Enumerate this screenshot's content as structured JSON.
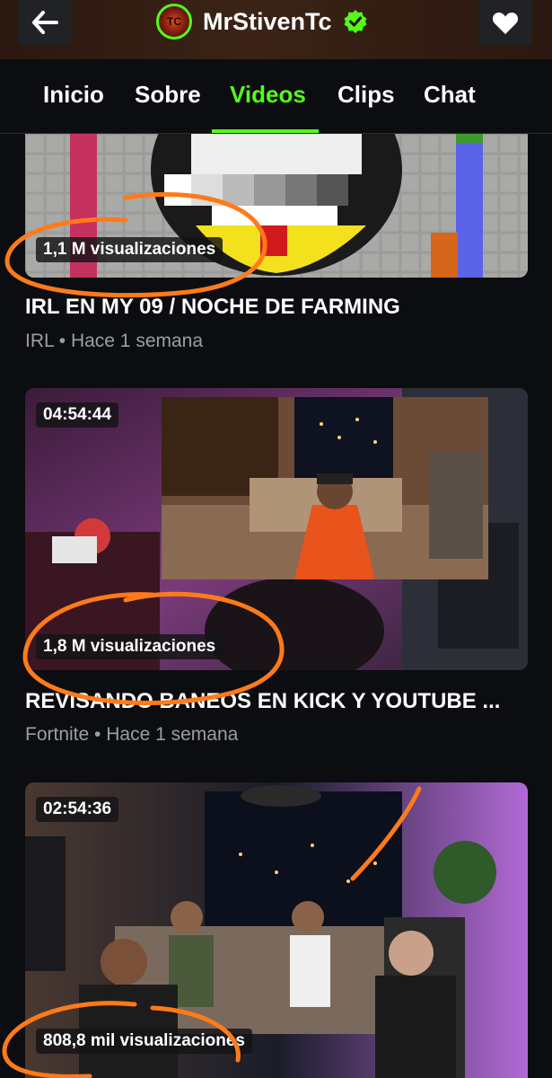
{
  "header": {
    "channel_name": "MrStivenTc",
    "avatar_text": "TC",
    "back_icon": "arrow-left-icon",
    "favorite_icon": "heart-icon",
    "verified_icon": "verified-badge-icon",
    "accent": "#53fc18"
  },
  "tabs": [
    {
      "label": "Inicio"
    },
    {
      "label": "Sobre"
    },
    {
      "label": "Videos"
    },
    {
      "label": "Clips"
    },
    {
      "label": "Chat"
    }
  ],
  "active_tab": "Videos",
  "videos": [
    {
      "views": "1,1 M visualizaciones",
      "title": "IRL EN MY 09 / NOCHE DE FARMING",
      "category": "IRL",
      "age": "Hace 1 semana"
    },
    {
      "duration": "04:54:44",
      "views": "1,8 M visualizaciones",
      "title": "REVISANDO BANEOS EN KICK Y YOUTUBE ...",
      "category": "Fortnite",
      "age": "Hace 1 semana"
    },
    {
      "duration": "02:54:36",
      "views": "808,8 mil visualizaciones"
    }
  ],
  "meta_separator": "•"
}
